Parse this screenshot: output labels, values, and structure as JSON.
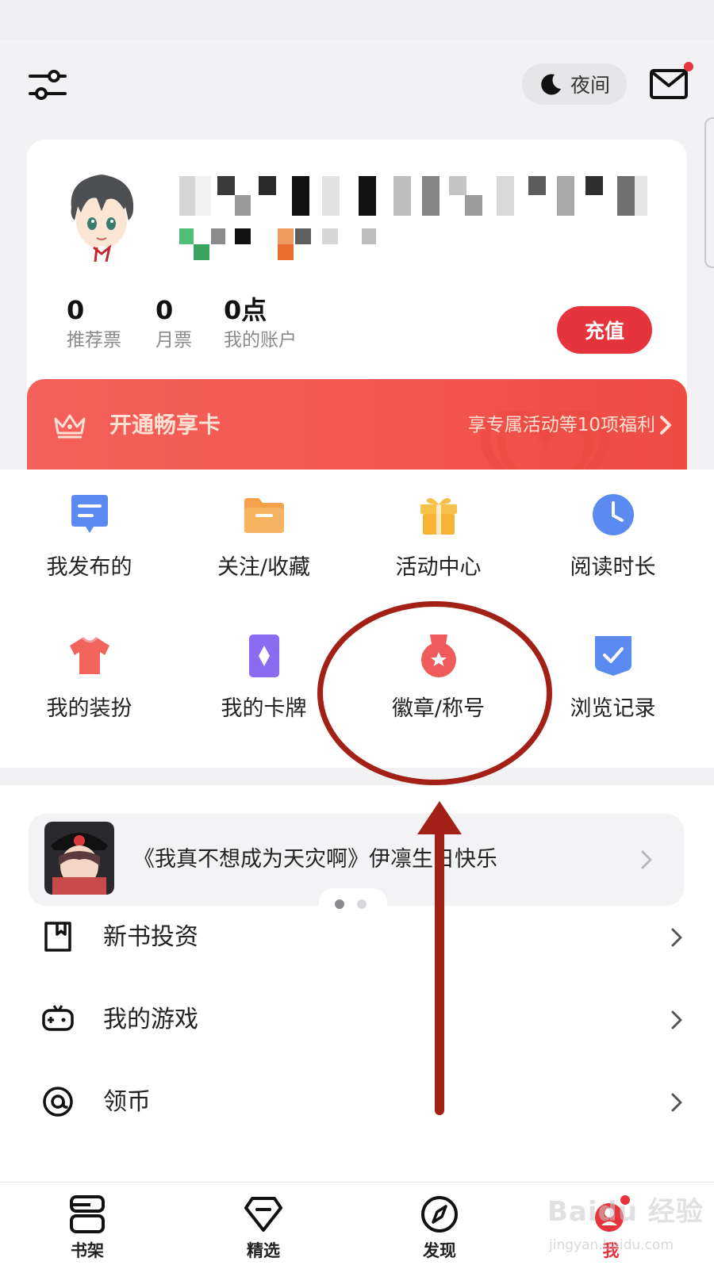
{
  "topbar": {
    "night_mode_label": "夜间",
    "icons": [
      "sliders-icon",
      "moon-icon",
      "mail-icon"
    ],
    "mail_has_badge": true
  },
  "profile": {
    "username_obscured": true,
    "stats": [
      {
        "value": "0",
        "label": "推荐票"
      },
      {
        "value": "0",
        "label": "月票"
      },
      {
        "value": "0点",
        "label": "我的账户"
      }
    ],
    "recharge_label": "充值"
  },
  "vip_banner": {
    "title": "开通畅享卡",
    "subtitle": "享专属活动等10项福利"
  },
  "grid": {
    "items": [
      {
        "label": "我发布的",
        "icon": "chat-bubble-icon",
        "color": "#5b8bf0"
      },
      {
        "label": "关注/收藏",
        "icon": "folder-icon",
        "color": "#f5a04a"
      },
      {
        "label": "活动中心",
        "icon": "gift-icon",
        "color": "#f7c04a"
      },
      {
        "label": "阅读时长",
        "icon": "clock-icon",
        "color": "#5b8bf0"
      },
      {
        "label": "我的装扮",
        "icon": "tshirt-icon",
        "color": "#f0645c"
      },
      {
        "label": "我的卡牌",
        "icon": "card-icon",
        "color": "#8a6cf2"
      },
      {
        "label": "徽章/称号",
        "icon": "medal-icon",
        "color": "#ef5a5a"
      },
      {
        "label": "浏览记录",
        "icon": "shield-check-icon",
        "color": "#5b8bf0"
      }
    ]
  },
  "promo": {
    "text": "《我真不想成为天灾啊》伊凛生日快乐",
    "page_count": 2,
    "active_page": 1
  },
  "list": {
    "items": [
      {
        "label": "新书投资",
        "icon": "bookmark-icon"
      },
      {
        "label": "我的游戏",
        "icon": "gamepad-icon"
      },
      {
        "label": "领币",
        "icon": "at-coin-icon"
      }
    ]
  },
  "bottom_nav": {
    "items": [
      {
        "label": "书架",
        "icon": "bookshelf-icon",
        "active": false
      },
      {
        "label": "精选",
        "icon": "diamond-icon",
        "active": false
      },
      {
        "label": "发现",
        "icon": "compass-icon",
        "active": false
      },
      {
        "label": "我",
        "icon": "profile-icon",
        "active": true
      }
    ],
    "active_color": "#e5343c"
  },
  "watermark": {
    "brand": "Baidu 经验",
    "url": "jingyan.baidu.com"
  },
  "colors": {
    "accent": "#e5343c",
    "annotation": "#a32017"
  }
}
